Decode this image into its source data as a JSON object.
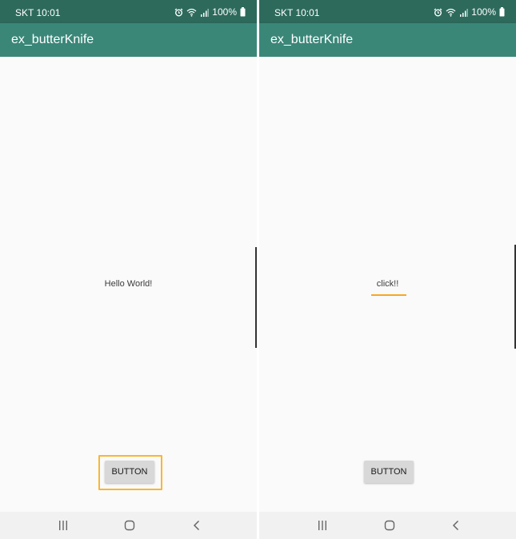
{
  "left": {
    "status": {
      "time": "SKT 10:01",
      "battery": "100%"
    },
    "app_title": "ex_butterKnife",
    "message": "Hello World!",
    "button_label": "BUTTON"
  },
  "right": {
    "status": {
      "time": "SKT 10:01",
      "battery": "100%"
    },
    "app_title": "ex_butterKnife",
    "message": "click!!",
    "button_label": "BUTTON"
  },
  "colors": {
    "status_bar": "#2d6a5c",
    "app_bar": "#3a8778",
    "highlight": "#f7b731"
  },
  "icons": {
    "status": [
      "alarm-icon",
      "wifi-icon",
      "signal-icon",
      "battery-icon"
    ],
    "nav": [
      "recents-icon",
      "home-icon",
      "back-icon"
    ]
  }
}
